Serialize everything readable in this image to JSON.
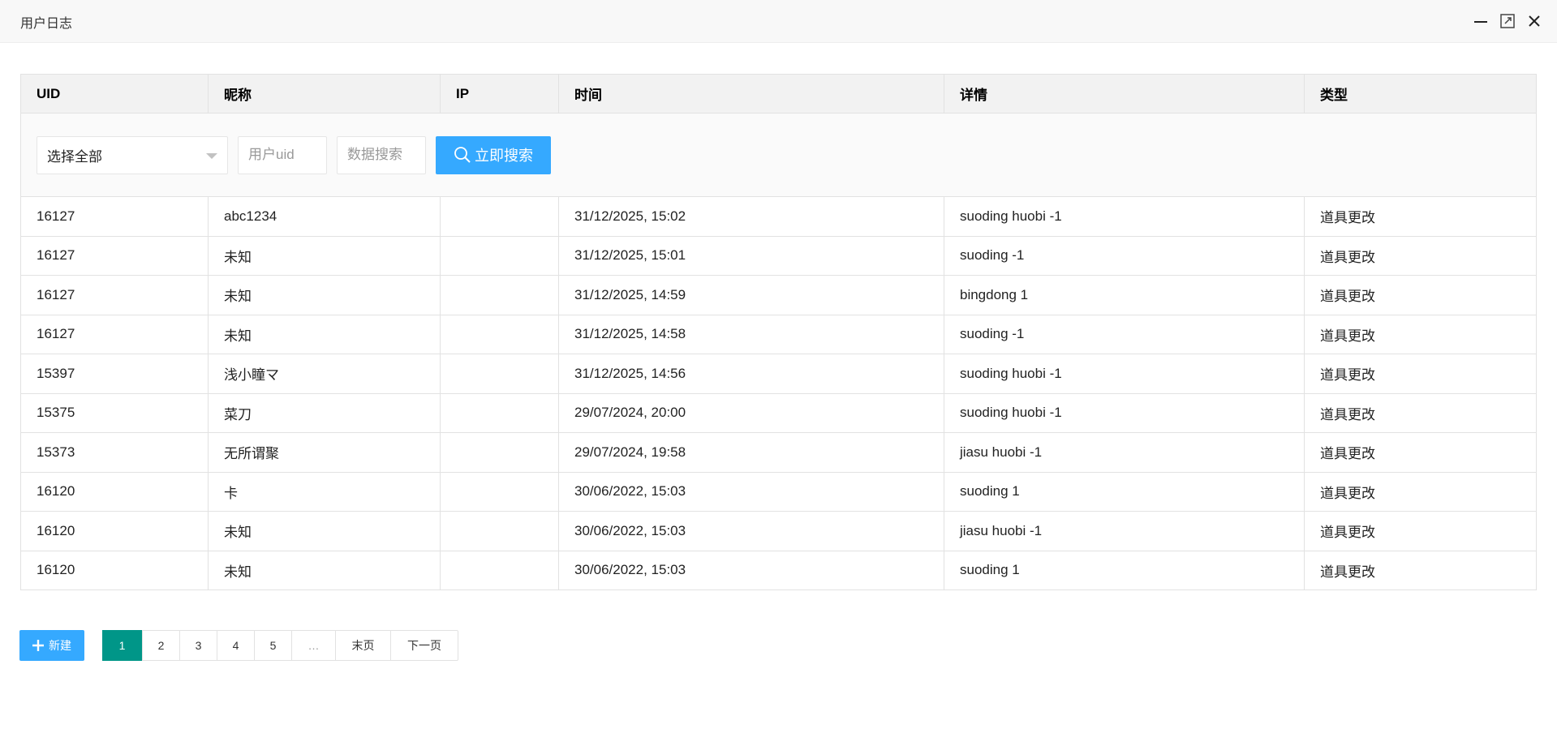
{
  "window": {
    "title": "用户日志"
  },
  "table": {
    "headers": [
      "UID",
      "昵称",
      "IP",
      "时间",
      "详情",
      "类型"
    ],
    "filter": {
      "select_value": "选择全部",
      "uid_placeholder": "用户uid",
      "data_placeholder": "数据搜索",
      "search_label": "立即搜索"
    },
    "rows": [
      [
        "16127",
        "abc1234",
        "",
        "31/12/2025, 15:02",
        "suoding huobi -1",
        "道具更改"
      ],
      [
        "16127",
        "未知",
        "",
        "31/12/2025, 15:01",
        "suoding -1",
        "道具更改"
      ],
      [
        "16127",
        "未知",
        "",
        "31/12/2025, 14:59",
        "bingdong 1",
        "道具更改"
      ],
      [
        "16127",
        "未知",
        "",
        "31/12/2025, 14:58",
        "suoding -1",
        "道具更改"
      ],
      [
        "15397",
        "浅小瞳マ",
        "",
        "31/12/2025, 14:56",
        "suoding huobi -1",
        "道具更改"
      ],
      [
        "15375",
        "菜刀",
        "",
        "29/07/2024, 20:00",
        "suoding huobi -1",
        "道具更改"
      ],
      [
        "15373",
        "无所谓聚",
        "",
        "29/07/2024, 19:58",
        "jiasu huobi -1",
        "道具更改"
      ],
      [
        "16120",
        "卡",
        "",
        "30/06/2022, 15:03",
        "suoding 1",
        "道具更改"
      ],
      [
        "16120",
        "未知",
        "",
        "30/06/2022, 15:03",
        "jiasu huobi -1",
        "道具更改"
      ],
      [
        "16120",
        "未知",
        "",
        "30/06/2022, 15:03",
        "suoding 1",
        "道具更改"
      ]
    ]
  },
  "footer": {
    "new_label": "新建",
    "pages": [
      "1",
      "2",
      "3",
      "4",
      "5",
      "…",
      "末页",
      "下一页"
    ],
    "current_page": "1"
  },
  "colors": {
    "accent": "#35a9ff",
    "active_page": "#009688"
  }
}
